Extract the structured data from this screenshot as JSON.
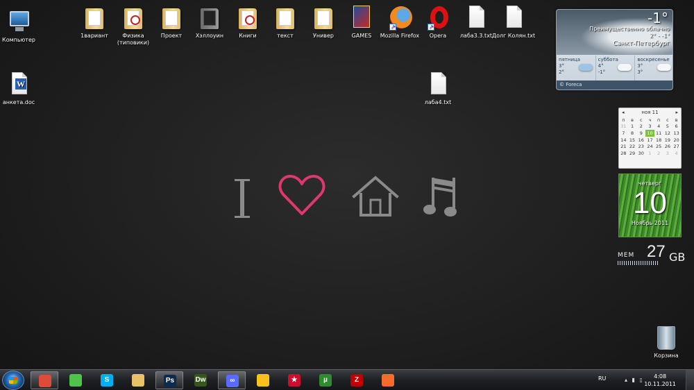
{
  "desktop_icons": [
    {
      "label": "Компьютер",
      "icon": "computer-icon"
    },
    {
      "label": "1вариант",
      "icon": "folder-icon"
    },
    {
      "label": "Физика (типовики)",
      "icon": "pdf-folder-icon"
    },
    {
      "label": "Проект",
      "icon": "folder-icon"
    },
    {
      "label": "Хэллоуин",
      "icon": "folder-icon"
    },
    {
      "label": "Книги",
      "icon": "pdf-folder-icon"
    },
    {
      "label": "текст",
      "icon": "folder-icon"
    },
    {
      "label": "Универ",
      "icon": "folder-icon"
    },
    {
      "label": "GAMES",
      "icon": "games-icon"
    },
    {
      "label": "Mozilla Firefox",
      "icon": "firefox-icon"
    },
    {
      "label": "Opera",
      "icon": "opera-icon"
    },
    {
      "label": "лаба3.3.txt",
      "icon": "text-file-icon"
    },
    {
      "label": "Долг Колян.txt",
      "icon": "text-file-icon"
    },
    {
      "label": "анкета.doc",
      "icon": "word-doc-icon"
    },
    {
      "label": "лаба4.txt",
      "icon": "text-file-icon"
    }
  ],
  "wallpaper": {
    "letter": "I",
    "symbols": [
      "heart-icon",
      "house-icon",
      "music-note-icon"
    ],
    "heart_color": "#e0386d",
    "symbol_color": "#8a8a8a"
  },
  "weather": {
    "temp": "-1°",
    "condition": "Преимущественно облачно",
    "range": "2° - -1°",
    "city": "Санкт-Петербург",
    "days": [
      {
        "name": "пятница",
        "high": "3°",
        "low": "2°"
      },
      {
        "name": "суббота",
        "high": "4°",
        "low": "-1°"
      },
      {
        "name": "воскресенье",
        "high": "3°",
        "low": "3°"
      }
    ],
    "provider": "© Foreca"
  },
  "calendar": {
    "month": "ноя 11",
    "weekdays": [
      "п",
      "в",
      "с",
      "ч",
      "п",
      "с",
      "в"
    ],
    "weeks": [
      [
        "31",
        "1",
        "2",
        "3",
        "4",
        "5",
        "6"
      ],
      [
        "7",
        "8",
        "9",
        "10",
        "11",
        "12",
        "13"
      ],
      [
        "14",
        "15",
        "16",
        "17",
        "18",
        "19",
        "20"
      ],
      [
        "21",
        "22",
        "23",
        "24",
        "25",
        "26",
        "27"
      ],
      [
        "28",
        "29",
        "30",
        "1",
        "2",
        "3",
        "4"
      ]
    ],
    "today": "10",
    "weekday_name": "четверг",
    "day_number": "10",
    "month_year": "Ноябрь 2011"
  },
  "memory": {
    "label": "MEM",
    "value": "27",
    "unit": "GB"
  },
  "recycle_bin": {
    "label": "Корзина"
  },
  "taskbar": {
    "pinned": [
      {
        "name": "chrome-icon",
        "label": "",
        "color": "#dd4b39",
        "active": true
      },
      {
        "name": "utorrent-like-icon",
        "label": "",
        "color": "#4fc34a",
        "active": false
      },
      {
        "name": "skype-icon",
        "label": "S",
        "color": "#00aff0",
        "active": false
      },
      {
        "name": "explorer-icon",
        "label": "",
        "color": "#e8c266",
        "active": false
      },
      {
        "name": "photoshop-icon",
        "label": "Ps",
        "color": "#0d2b4e",
        "active": true
      },
      {
        "name": "dreamweaver-icon",
        "label": "Dw",
        "color": "#35571c",
        "active": false
      },
      {
        "name": "infinity-icon",
        "label": "∞",
        "color": "#5a6cff",
        "active": true
      },
      {
        "name": "icq-icon",
        "label": "",
        "color": "#f6c21b",
        "active": false
      },
      {
        "name": "pokerstars-icon",
        "label": "★",
        "color": "#c8102e",
        "active": false
      },
      {
        "name": "utorrent-icon",
        "label": "µ",
        "color": "#2e8b2e",
        "active": false
      },
      {
        "name": "filezilla-icon",
        "label": "Z",
        "color": "#bf0000",
        "active": false
      },
      {
        "name": "origin-icon",
        "label": "",
        "color": "#f56c2d",
        "active": false
      }
    ],
    "tray": {
      "lang": "RU",
      "time": "4:08",
      "date": "10.11.2011"
    }
  }
}
